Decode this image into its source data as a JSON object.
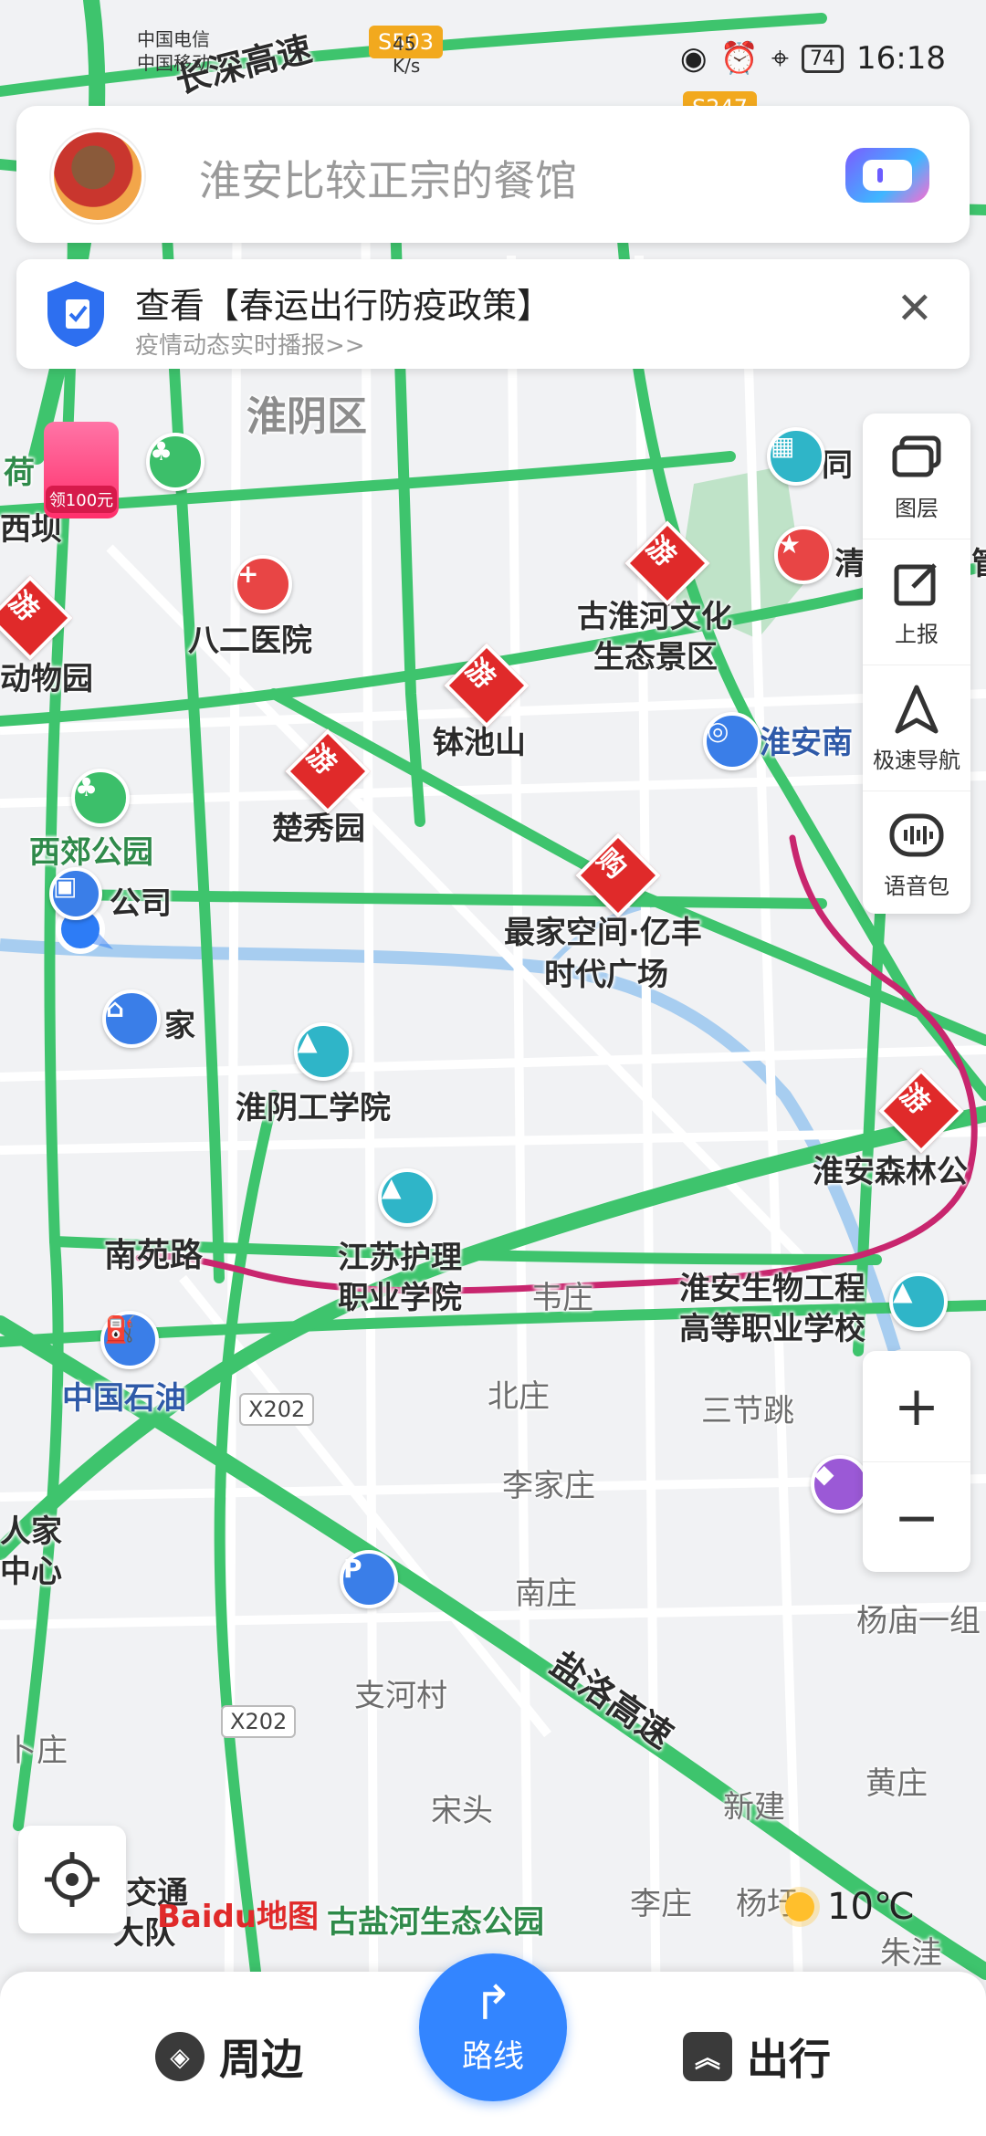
{
  "status_bar": {
    "carrier_1": "中国电信",
    "carrier_2": "中国移动",
    "speed": "45 K/s",
    "battery": "74",
    "time": "16:18"
  },
  "search": {
    "placeholder": "淮安比较正宗的餐馆"
  },
  "notice": {
    "title": "查看【春运出行防疫政策】",
    "subtitle": "疫情动态实时播报>>"
  },
  "tools": [
    {
      "label": "图层",
      "icon": "layers-icon"
    },
    {
      "label": "上报",
      "icon": "report-icon"
    },
    {
      "label": "极速导航",
      "icon": "navigation-icon"
    },
    {
      "label": "语音包",
      "icon": "voice-pack-icon"
    }
  ],
  "promo": {
    "label": "领100元"
  },
  "map": {
    "district": "淮阴区",
    "road_labels": {
      "changshen": "长深高速",
      "yanluo": "盐洛高速",
      "s503": "S503",
      "s247": "S247",
      "x202_a": "X202",
      "x202_b": "X202",
      "nanyuan": "南苑路"
    },
    "pois": {
      "bayi": "八二医院",
      "guhuaihe_1": "古淮河文化",
      "guhuaihe_2": "生态景区",
      "bochishan": "钵池山",
      "chuxiu": "楚秀园",
      "xijiao": "西郊公园",
      "company": "公司",
      "home": "家",
      "zuijia_1": "最家空间·亿丰",
      "zuijia_2": "时代广场",
      "huaiannan": "淮安南",
      "huaiyin_tech": "淮阴工学院",
      "jiangsu_nursing_1": "江苏护理",
      "jiangsu_nursing_2": "职业学院",
      "forest": "淮安森林公",
      "bio_1": "淮安生物工程",
      "bio_2": "高等职业学校",
      "sinopec": "中国石油",
      "zoo": "动物园",
      "heyuan": "荷",
      "guyanhe": "古盐河生态公园",
      "qing": "清",
      "tong": "同",
      "traffic_1": "交通",
      "traffic_2": "大队",
      "renjia_1": "人家",
      "renjia_2": "中心",
      "xiba": "西坝",
      "guan": "管"
    },
    "places": {
      "beizhuang": "北庄",
      "sanjietiao": "三节跳",
      "lijiazhuang": "李家庄",
      "nanzhuang": "南庄",
      "zhihecun": "支河村",
      "songtou": "宋头",
      "lizhuang": "李庄",
      "xinjian": "新建",
      "huangzhuang": "黄庄",
      "yangmiaoyizu": "杨庙一组",
      "zhuwa": "朱洼",
      "yangba": "杨圩",
      "xizhuang": "卜庄",
      "hanzhuang": "韦庄"
    }
  },
  "weather": {
    "temperature": "10℃"
  },
  "logo": {
    "text": "Baidu地图"
  },
  "bottom_bar": {
    "nearby": "周边",
    "route": "路线",
    "travel": "出行"
  },
  "colors": {
    "road_green": "#3ec46d",
    "route_magenta": "#c8266e",
    "accent_blue": "#3385ff",
    "poi_red": "#e02a2a"
  }
}
